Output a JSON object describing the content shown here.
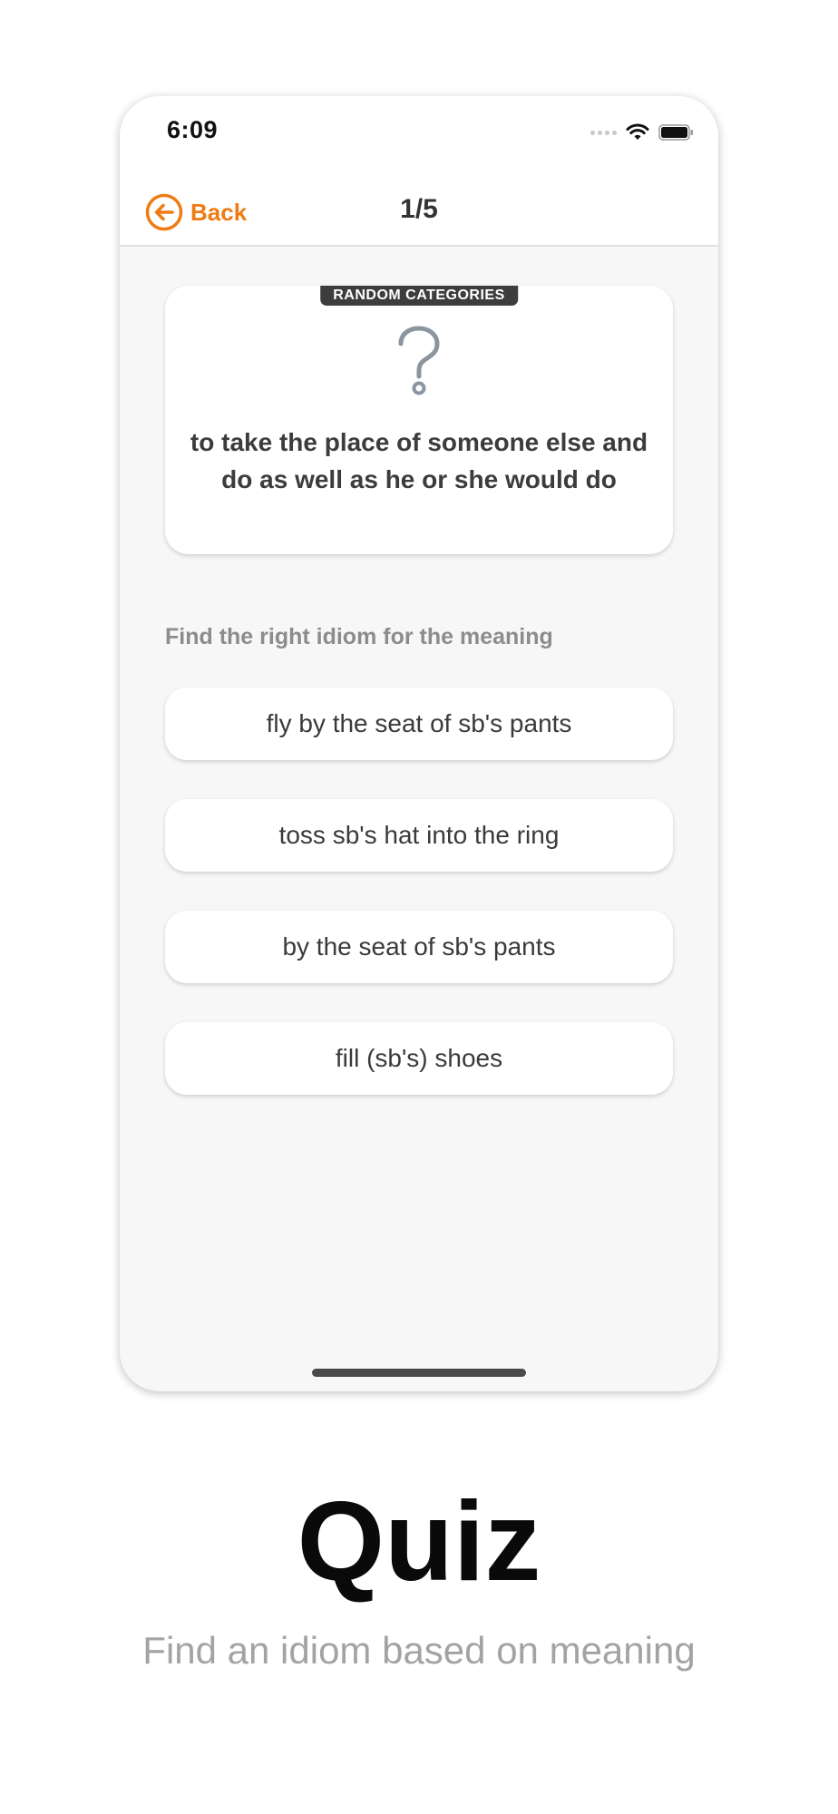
{
  "status_bar": {
    "time": "6:09"
  },
  "nav": {
    "back_label": "Back",
    "title": "1/5"
  },
  "question": {
    "category": "RANDOM CATEGORIES",
    "icon": "question-mark-icon",
    "meaning": "to take the place of someone else and do as well as he or she would do"
  },
  "prompt": "Find the right idiom for the meaning",
  "options": [
    "fly by the seat of sb's pants",
    "toss sb's hat into the ring",
    "by the seat of sb's pants",
    "fill (sb's) shoes"
  ],
  "caption": {
    "title": "Quiz",
    "subtitle": "Find an idiom based on meaning"
  },
  "colors": {
    "accent": "#ee7b14",
    "badge_bg": "#3d3d3d",
    "screen_bg": "#f7f7f7"
  }
}
